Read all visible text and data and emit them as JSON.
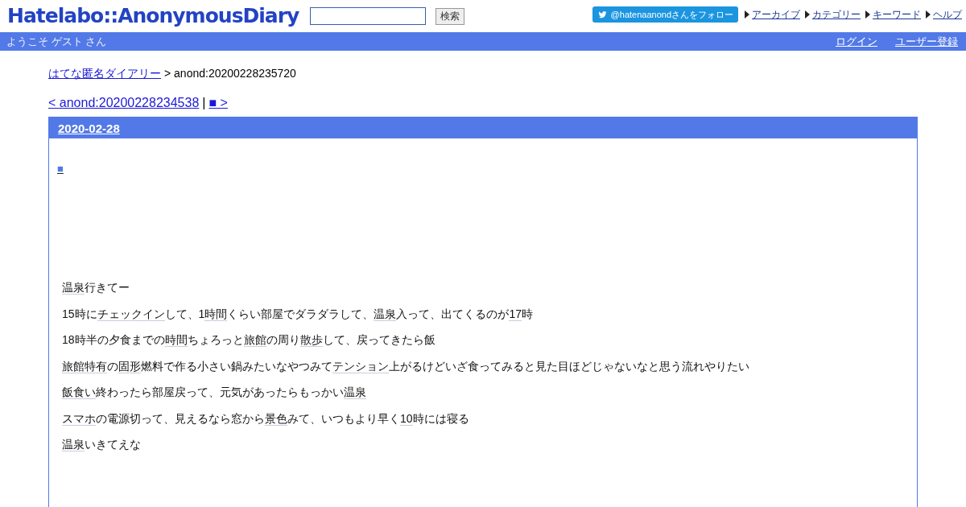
{
  "header": {
    "logo": "Hatelabo::AnonymousDiary",
    "search_button": "検索",
    "follow_button": "@hatenaanondさんをフォロー",
    "nav": [
      "アーカイブ",
      "カテゴリー",
      "キーワード",
      "ヘルプ"
    ]
  },
  "user_bar": {
    "welcome": "ようこそ ゲスト さん",
    "links": [
      "ログイン",
      "ユーザー登録"
    ]
  },
  "breadcrumb": {
    "link": "はてな匿名ダイアリー",
    "current": "> anond:20200228235720"
  },
  "pager": {
    "prev": "< anond:20200228234538",
    "separator": "|",
    "next": "■ >"
  },
  "entry": {
    "date": "2020-02-28",
    "title_link": "■",
    "paragraphs": [
      [
        {
          "text": "温泉",
          "keyword": true
        },
        {
          "text": "行きてー",
          "keyword": false
        }
      ],
      [
        {
          "text": "15時に",
          "keyword": false
        },
        {
          "text": "チェックイン",
          "keyword": true
        },
        {
          "text": "して、1",
          "keyword": false
        },
        {
          "text": "時間",
          "keyword": true
        },
        {
          "text": "くらい部屋でダラダラして、",
          "keyword": false
        },
        {
          "text": "温泉",
          "keyword": true
        },
        {
          "text": "入って、出てくるのが",
          "keyword": false
        },
        {
          "text": "17",
          "keyword": true
        },
        {
          "text": "時",
          "keyword": false
        }
      ],
      [
        {
          "text": "18時半の夕食までの",
          "keyword": false
        },
        {
          "text": "時間",
          "keyword": true
        },
        {
          "text": "ちょろっと",
          "keyword": false
        },
        {
          "text": "旅館",
          "keyword": true
        },
        {
          "text": "の周り",
          "keyword": false
        },
        {
          "text": "散歩",
          "keyword": true
        },
        {
          "text": "して、戻ってきたら飯",
          "keyword": false
        }
      ],
      [
        {
          "text": "旅館特有",
          "keyword": true
        },
        {
          "text": "の",
          "keyword": false
        },
        {
          "text": "固形",
          "keyword": true
        },
        {
          "text": "燃料で作る小さい鍋みたいなやつみて",
          "keyword": false
        },
        {
          "text": "テンション",
          "keyword": true
        },
        {
          "text": "上がるけどいざ食ってみると見た目ほどじゃないなと思う流れやりたい",
          "keyword": false
        }
      ],
      [
        {
          "text": "飯食い",
          "keyword": true
        },
        {
          "text": "終わったら部屋戻って、元気があったらもっかい",
          "keyword": false
        },
        {
          "text": "温泉",
          "keyword": true
        }
      ],
      [
        {
          "text": "スマホ",
          "keyword": true
        },
        {
          "text": "の電源切って、見えるなら窓から",
          "keyword": false
        },
        {
          "text": "景色",
          "keyword": true
        },
        {
          "text": "みて、いつもより早く",
          "keyword": false
        },
        {
          "text": "10",
          "keyword": true
        },
        {
          "text": "時には寝る",
          "keyword": false
        }
      ],
      [
        {
          "text": "温泉",
          "keyword": true
        },
        {
          "text": "いきてえな",
          "keyword": false
        }
      ]
    ]
  }
}
